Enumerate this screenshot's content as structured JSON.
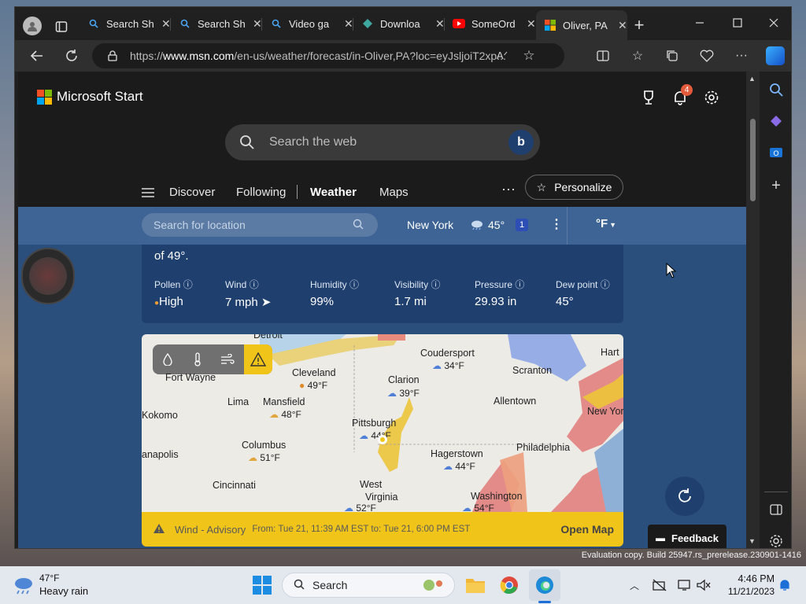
{
  "browser": {
    "tabs": [
      {
        "label": "Search Sh",
        "icon": "search-icon"
      },
      {
        "label": "Search Sh",
        "icon": "search-icon"
      },
      {
        "label": "Video ga",
        "icon": "search-icon"
      },
      {
        "label": "Downloa",
        "icon": "download-icon"
      },
      {
        "label": "SomeOrd",
        "icon": "youtube-icon"
      },
      {
        "label": "Oliver, PA",
        "icon": "msn-icon"
      }
    ],
    "url_prefix": "https://",
    "url_host": "www.msn.com",
    "url_rest": "/en-us/weather/forecast/in-Oliver,PA?loc=eyJsljoiT2xp..."
  },
  "msn": {
    "logo_text": "Microsoft Start",
    "notif_count": "4",
    "search_placeholder": "Search the web",
    "nav": [
      "Discover",
      "Following",
      "Weather",
      "Maps"
    ],
    "personalize": "Personalize"
  },
  "weather_bar": {
    "location_placeholder": "Search for location",
    "city": "New York",
    "temp": "45°",
    "alert_count": "1",
    "unit": "°F"
  },
  "details": {
    "partial_text": "of 49°.",
    "metrics": [
      {
        "label": "Pollen",
        "value": "High"
      },
      {
        "label": "Wind",
        "value": "7 mph"
      },
      {
        "label": "Humidity",
        "value": "99%"
      },
      {
        "label": "Visibility",
        "value": "1.7 mi"
      },
      {
        "label": "Pressure",
        "value": "29.93 in"
      },
      {
        "label": "Dew point",
        "value": "45°"
      }
    ]
  },
  "map": {
    "cities": [
      "Detroit",
      "Fort Wayne",
      "Kokomo",
      "Lima",
      "Mansfield",
      "Cleveland",
      "Columbus",
      "Cincinnati",
      "anapolis",
      "Clarion",
      "Coudersport",
      "Scranton",
      "Allentown",
      "New York",
      "Hart",
      "Pittsburgh",
      "Philadelphia",
      "Hagerstown",
      "West",
      "Virginia",
      "Washington"
    ],
    "temps": [
      "49°F",
      "48°F",
      "51°F",
      "39°F",
      "34°F",
      "44°F",
      "44°F",
      "52°F",
      "54°F"
    ]
  },
  "alert": {
    "title": "Wind - Advisory",
    "range": "From: Tue 21, 11:39 AM EST to: Tue 21, 6:00 PM EST",
    "action": "Open Map"
  },
  "feedback": "Feedback",
  "watermark": "Evaluation copy. Build 25947.rs_prerelease.230901-1416",
  "taskbar": {
    "weather_temp": "47°F",
    "weather_desc": "Heavy rain",
    "search": "Search",
    "time": "4:46 PM",
    "date": "11/21/2023"
  },
  "colors": {
    "accent": "#0078d4",
    "alert": "#f0c419",
    "weatherbar": "#3d6495",
    "card": "#1f3f6f"
  }
}
